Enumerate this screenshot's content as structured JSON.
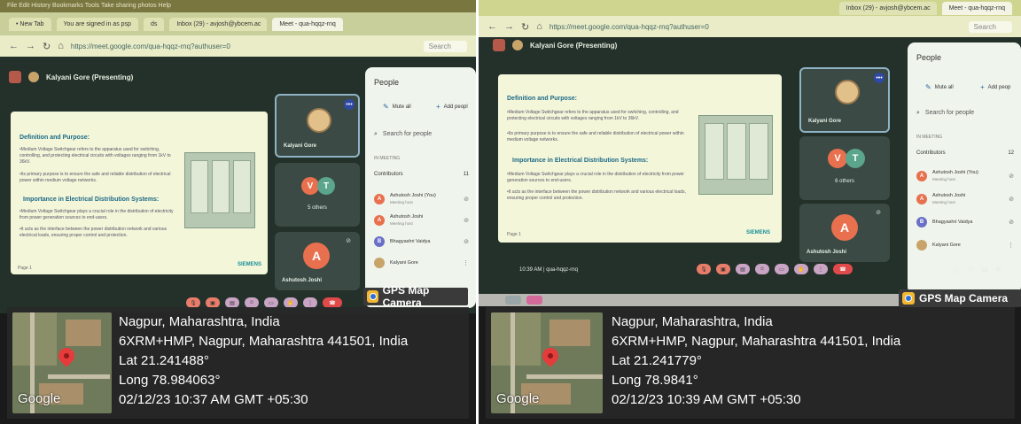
{
  "photos": [
    {
      "browser": {
        "menu": "File  Edit  History  Bookmarks  Tools  Take sharing photos  Help",
        "tabs": [
          "• New Tab",
          "You are signed in as psp",
          "ds",
          "Inbox (29) - avjosh@ybcem.ac",
          "Meet - qua-hqqz-rnq"
        ],
        "url": "https://meet.google.com/qua-hqqz-rnq?authuser=0",
        "search_placeholder": "Search"
      },
      "meet": {
        "presenter": "Kalyani Gore (Presenting)",
        "slide": {
          "heading1": "Definition and Purpose:",
          "para1": "•Medium Voltage Switchgear refers to the apparatus used for switching, controlling, and protecting electrical circuits with voltages ranging from 1kV to 36kV.",
          "para1b": "•Its primary purpose is to ensure the safe and reliable distribution of electrical power within medium voltage networks.",
          "heading2": "Importance in Electrical Distribution Systems:",
          "para2": "•Medium Voltage Switchgear plays a crucial role in the distribution of electricity from power generation sources to end-users.",
          "para2b": "•It acts as the interface between the power distribution network and various electrical loads, ensuring proper control and protection.",
          "footer": "Page 1",
          "brand": "SIEMENS"
        },
        "tiles": [
          {
            "label": "Kalyani Gore"
          },
          {
            "initials": [
              "V",
              "T"
            ],
            "label": "5 others"
          },
          {
            "initial": "A",
            "label": "Ashutosh Joshi"
          }
        ],
        "people": {
          "title": "People",
          "mute_all": "Mute all",
          "add_people": "Add peopl",
          "search": "Search for people",
          "section": "IN MEETING",
          "contributors": "Contributors",
          "contributors_count": "11",
          "list": [
            {
              "initial": "A",
              "name": "Ashutosh Joshi (You)",
              "sub": "Meeting host"
            },
            {
              "initial": "A",
              "name": "Ashutosh Joshi",
              "sub": "Meeting host"
            },
            {
              "initial": "B",
              "name": "Bhagyashri Vaidya",
              "sub": ""
            },
            {
              "initial": "",
              "name": "Kalyani Gore",
              "sub": ""
            }
          ]
        }
      },
      "gps": {
        "badge": "GPS Map Camera",
        "logo": "Google",
        "city": "Nagpur, Maharashtra, India",
        "address": "6XRM+HMP, Nagpur, Maharashtra 441501, India",
        "lat": "Lat 21.241488°",
        "long": "Long 78.984063°",
        "datetime": "02/12/23 10:37 AM GMT +05:30"
      }
    },
    {
      "browser": {
        "tabs": [
          "Inbox (29) - avjosh@ybcem.ac",
          "Meet - qua-hqqz-rnq"
        ],
        "url": "https://meet.google.com/qua-hqqz-rnq?authuser=0",
        "search_placeholder": "Search"
      },
      "meet": {
        "presenter": "Kalyani Gore (Presenting)",
        "slide": {
          "heading1": "Definition and Purpose:",
          "para1": "•Medium Voltage Switchgear refers to the apparatus used for switching, controlling, and protecting electrical circuits with voltages ranging from 1kV to 36kV.",
          "para1b": "•Its primary purpose is to ensure the safe and reliable distribution of electrical power within medium voltage networks.",
          "heading2": "Importance in Electrical Distribution Systems:",
          "para2": "•Medium Voltage Switchgear plays a crucial role in the distribution of electricity from power generation sources to end-users.",
          "para2b": "•It acts as the interface between the power distribution network and various electrical loads, ensuring proper control and protection.",
          "footer": "Page 1",
          "brand": "SIEMENS"
        },
        "tiles": [
          {
            "label": "Kalyani Gore"
          },
          {
            "initials": [
              "V",
              "T"
            ],
            "label": "6 others"
          },
          {
            "initial": "A",
            "label": "Ashutosh Joshi"
          }
        ],
        "people": {
          "title": "People",
          "mute_all": "Mute all",
          "add_people": "Add peop",
          "search": "Search for people",
          "section": "IN MEETING",
          "contributors": "Contributors",
          "contributors_count": "12",
          "list": [
            {
              "initial": "A",
              "name": "Ashutosh Joshi (You)",
              "sub": "Meeting host"
            },
            {
              "initial": "A",
              "name": "Ashutosh Joshi",
              "sub": "Meeting host"
            },
            {
              "initial": "B",
              "name": "Bhagyashri Vaidya",
              "sub": ""
            },
            {
              "initial": "",
              "name": "Kalyani Gore",
              "sub": ""
            }
          ]
        },
        "time_code": "10:39 AM  |  qua-hqqz-rnq"
      },
      "gps": {
        "badge": "GPS Map Camera",
        "logo": "Google",
        "city": "Nagpur, Maharashtra, India",
        "address": "6XRM+HMP, Nagpur, Maharashtra 441501, India",
        "lat": "Lat 21.241779°",
        "long": "Long 78.9841°",
        "datetime": "02/12/23 10:39 AM GMT +05:30"
      }
    }
  ],
  "colors": {
    "avatar_orange": "#e8704e",
    "avatar_teal": "#5aa58c",
    "avatar_purple": "#6a6fc8",
    "gps_pin": "#e53b3b"
  }
}
